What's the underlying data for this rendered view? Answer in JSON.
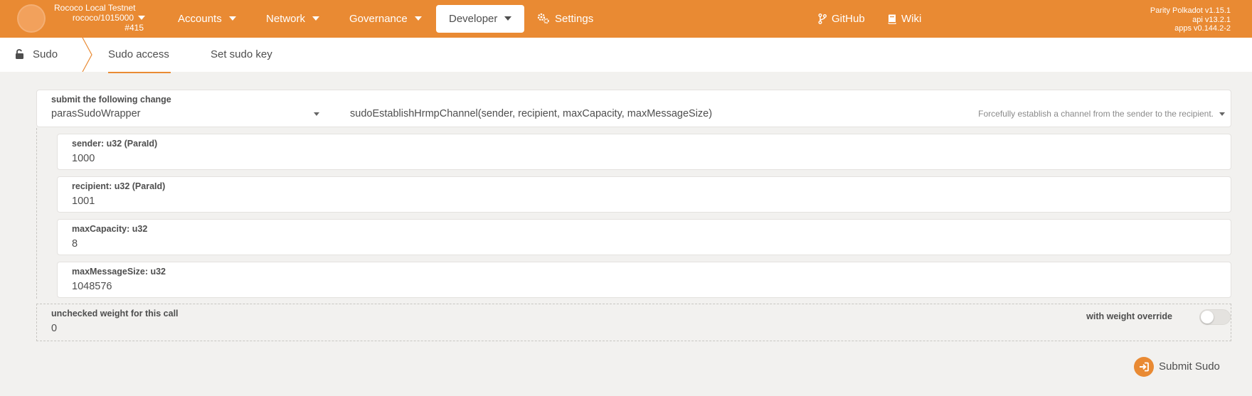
{
  "chain": {
    "name": "Rococo Local Testnet",
    "spec": "rococo/1015000",
    "block": "#415"
  },
  "menu": {
    "accounts": "Accounts",
    "network": "Network",
    "governance": "Governance",
    "developer": "Developer",
    "settings": "Settings",
    "github": "GitHub",
    "wiki": "Wiki"
  },
  "versions": {
    "node": "Parity Polkadot v1.15.1",
    "api": "api v13.2.1",
    "apps": "apps v0.144.2-2"
  },
  "tabs": {
    "root": "Sudo",
    "sudo_access": "Sudo access",
    "set_sudo_key": "Set sudo key"
  },
  "call": {
    "label": "submit the following change",
    "section": "parasSudoWrapper",
    "method": "sudoEstablishHrmpChannel(sender, recipient, maxCapacity, maxMessageSize)",
    "description": "Forcefully establish a channel from the sender to the recipient."
  },
  "params": [
    {
      "label": "sender: u32 (ParaId)",
      "value": "1000"
    },
    {
      "label": "recipient: u32 (ParaId)",
      "value": "1001"
    },
    {
      "label": "maxCapacity: u32",
      "value": "8"
    },
    {
      "label": "maxMessageSize: u32",
      "value": "1048576"
    }
  ],
  "weight": {
    "label": "unchecked weight for this call",
    "value": "0",
    "override_label": "with weight override",
    "override_enabled": false
  },
  "submit_label": "Submit Sudo",
  "colors": {
    "accent": "#e98a33",
    "background": "#f2f1ef"
  }
}
